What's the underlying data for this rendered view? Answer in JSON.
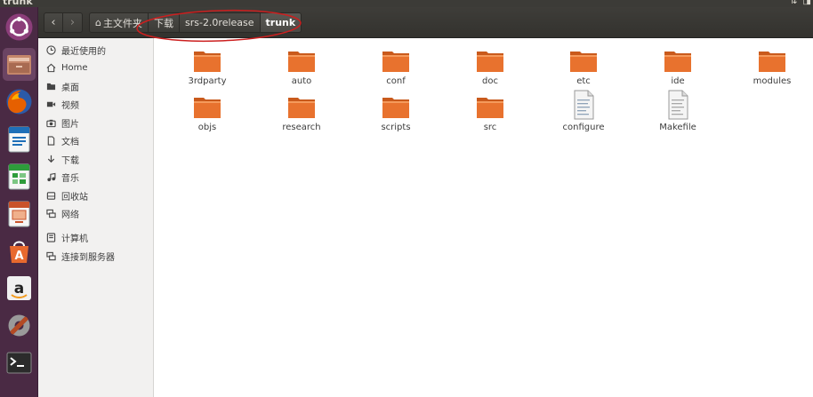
{
  "window": {
    "title": "trunk"
  },
  "top_panel": {
    "icons": [
      "⇅",
      "◨"
    ]
  },
  "launcher": {
    "items": [
      {
        "name": "dash-icon",
        "color": "#e95420"
      },
      {
        "name": "files-icon",
        "color": "#c4866a"
      },
      {
        "name": "firefox-icon",
        "color": "#e66000"
      },
      {
        "name": "writer-icon",
        "color": "#1e6fb8"
      },
      {
        "name": "calc-icon",
        "color": "#2e9c3b"
      },
      {
        "name": "impress-icon",
        "color": "#c9532a"
      },
      {
        "name": "software-center-icon",
        "color": "#e8692e"
      },
      {
        "name": "amazon-icon",
        "color": "#f0f0f0"
      },
      {
        "name": "settings-icon",
        "color": "#b34a24"
      },
      {
        "name": "terminal-icon",
        "color": "#2b2b2b"
      }
    ]
  },
  "header": {
    "back_glyph": "‹",
    "forward_glyph": "›",
    "home_glyph": "⌂",
    "breadcrumbs": [
      "主文件夹",
      "下载",
      "srs-2.0release",
      "trunk"
    ]
  },
  "sidebar": {
    "items": [
      {
        "label": "最近使用的",
        "icon": "clock-icon"
      },
      {
        "label": "Home",
        "icon": "home-icon"
      },
      {
        "label": "桌面",
        "icon": "desktop-icon"
      },
      {
        "label": "视频",
        "icon": "video-icon"
      },
      {
        "label": "图片",
        "icon": "camera-icon"
      },
      {
        "label": "文档",
        "icon": "document-icon"
      },
      {
        "label": "下载",
        "icon": "download-icon"
      },
      {
        "label": "音乐",
        "icon": "music-icon"
      },
      {
        "label": "回收站",
        "icon": "trash-icon"
      },
      {
        "label": "网络",
        "icon": "network-icon"
      },
      {
        "label": "计算机",
        "icon": "computer-icon"
      },
      {
        "label": "连接到服务器",
        "icon": "server-icon"
      }
    ]
  },
  "files": [
    {
      "name": "3rdparty",
      "type": "folder"
    },
    {
      "name": "auto",
      "type": "folder"
    },
    {
      "name": "conf",
      "type": "folder"
    },
    {
      "name": "doc",
      "type": "folder"
    },
    {
      "name": "etc",
      "type": "folder"
    },
    {
      "name": "ide",
      "type": "folder"
    },
    {
      "name": "modules",
      "type": "folder"
    },
    {
      "name": "objs",
      "type": "folder"
    },
    {
      "name": "research",
      "type": "folder"
    },
    {
      "name": "scripts",
      "type": "folder"
    },
    {
      "name": "src",
      "type": "folder"
    },
    {
      "name": "configure",
      "type": "text"
    },
    {
      "name": "Makefile",
      "type": "text"
    }
  ],
  "colors": {
    "folder": "#e8722e",
    "folder_dark": "#c95a1c",
    "annotation": "#cc1f1f"
  }
}
